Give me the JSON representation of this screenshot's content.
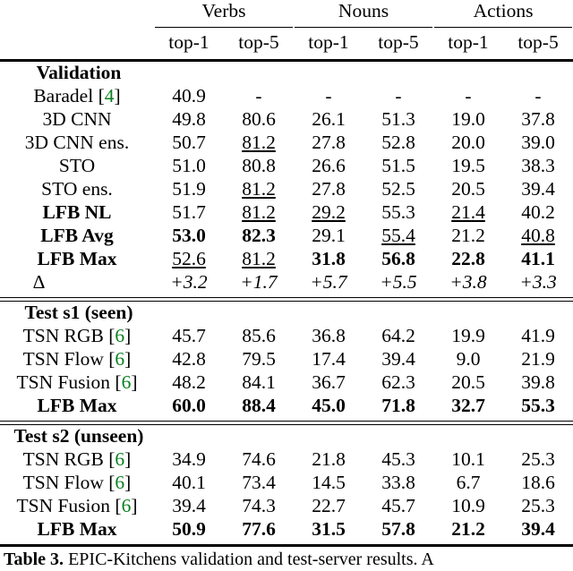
{
  "figure": {
    "kind": "results-table",
    "caption_prefix": "Table 3.",
    "caption_text": " EPIC-Kitchens validation and test-server results. A"
  },
  "table": {
    "column_groups": [
      {
        "label": "Verbs",
        "span": 2
      },
      {
        "label": "Nouns",
        "span": 2
      },
      {
        "label": "Actions",
        "span": 2
      }
    ],
    "subheaders": [
      "top-1",
      "top-5",
      "top-1",
      "top-5",
      "top-1",
      "top-5"
    ],
    "label_header": "",
    "cite_color": "#0a8020",
    "sections": [
      {
        "title": "Validation",
        "rows": [
          {
            "label": "Baradel",
            "cite": "4",
            "bold_label": false,
            "values": [
              "40.9",
              "-",
              "-",
              "-",
              "-",
              "-"
            ],
            "bold": [
              false,
              false,
              false,
              false,
              false,
              false
            ],
            "underline": [
              false,
              false,
              false,
              false,
              false,
              false
            ]
          },
          {
            "label": "3D CNN",
            "cite": null,
            "bold_label": false,
            "values": [
              "49.8",
              "80.6",
              "26.1",
              "51.3",
              "19.0",
              "37.8"
            ],
            "bold": [
              false,
              false,
              false,
              false,
              false,
              false
            ],
            "underline": [
              false,
              false,
              false,
              false,
              false,
              false
            ]
          },
          {
            "label": "3D CNN ens.",
            "cite": null,
            "bold_label": false,
            "values": [
              "50.7",
              "81.2",
              "27.8",
              "52.8",
              "20.0",
              "39.0"
            ],
            "bold": [
              false,
              false,
              false,
              false,
              false,
              false
            ],
            "underline": [
              false,
              true,
              false,
              false,
              false,
              false
            ]
          },
          {
            "label": "STO",
            "cite": null,
            "bold_label": false,
            "values": [
              "51.0",
              "80.8",
              "26.6",
              "51.5",
              "19.5",
              "38.3"
            ],
            "bold": [
              false,
              false,
              false,
              false,
              false,
              false
            ],
            "underline": [
              false,
              false,
              false,
              false,
              false,
              false
            ]
          },
          {
            "label": "STO ens.",
            "cite": null,
            "bold_label": false,
            "values": [
              "51.9",
              "81.2",
              "27.8",
              "52.5",
              "20.5",
              "39.4"
            ],
            "bold": [
              false,
              false,
              false,
              false,
              false,
              false
            ],
            "underline": [
              false,
              true,
              false,
              false,
              false,
              false
            ]
          },
          {
            "label": "LFB NL",
            "cite": null,
            "bold_label": true,
            "values": [
              "51.7",
              "81.2",
              "29.2",
              "55.3",
              "21.4",
              "40.2"
            ],
            "bold": [
              false,
              false,
              false,
              false,
              false,
              false
            ],
            "underline": [
              false,
              true,
              true,
              false,
              true,
              false
            ]
          },
          {
            "label": "LFB Avg",
            "cite": null,
            "bold_label": true,
            "values": [
              "53.0",
              "82.3",
              "29.1",
              "55.4",
              "21.2",
              "40.8"
            ],
            "bold": [
              true,
              true,
              false,
              false,
              false,
              false
            ],
            "underline": [
              false,
              false,
              false,
              true,
              false,
              true
            ]
          },
          {
            "label": "LFB Max",
            "cite": null,
            "bold_label": true,
            "values": [
              "52.6",
              "81.2",
              "31.8",
              "56.8",
              "22.8",
              "41.1"
            ],
            "bold": [
              false,
              false,
              true,
              true,
              true,
              true
            ],
            "underline": [
              true,
              true,
              false,
              false,
              false,
              false
            ]
          },
          {
            "label": "Δ",
            "cite": null,
            "is_delta": true,
            "bold_label": false,
            "values": [
              "+3.2",
              "+1.7",
              "+5.7",
              "+5.5",
              "+3.8",
              "+3.3"
            ],
            "bold": [
              false,
              false,
              false,
              false,
              false,
              false
            ],
            "underline": [
              false,
              false,
              false,
              false,
              false,
              false
            ]
          }
        ]
      },
      {
        "title": "Test s1 (seen)",
        "rows": [
          {
            "label": "TSN RGB",
            "cite": "6",
            "bold_label": false,
            "values": [
              "45.7",
              "85.6",
              "36.8",
              "64.2",
              "19.9",
              "41.9"
            ],
            "bold": [
              false,
              false,
              false,
              false,
              false,
              false
            ],
            "underline": [
              false,
              false,
              false,
              false,
              false,
              false
            ]
          },
          {
            "label": "TSN Flow",
            "cite": "6",
            "bold_label": false,
            "values": [
              "42.8",
              "79.5",
              "17.4",
              "39.4",
              "9.0",
              "21.9"
            ],
            "bold": [
              false,
              false,
              false,
              false,
              false,
              false
            ],
            "underline": [
              false,
              false,
              false,
              false,
              false,
              false
            ]
          },
          {
            "label": "TSN Fusion",
            "cite": "6",
            "bold_label": false,
            "values": [
              "48.2",
              "84.1",
              "36.7",
              "62.3",
              "20.5",
              "39.8"
            ],
            "bold": [
              false,
              false,
              false,
              false,
              false,
              false
            ],
            "underline": [
              false,
              false,
              false,
              false,
              false,
              false
            ]
          },
          {
            "label": "LFB Max",
            "cite": null,
            "bold_label": true,
            "values": [
              "60.0",
              "88.4",
              "45.0",
              "71.8",
              "32.7",
              "55.3"
            ],
            "bold": [
              true,
              true,
              true,
              true,
              true,
              true
            ],
            "underline": [
              false,
              false,
              false,
              false,
              false,
              false
            ]
          }
        ]
      },
      {
        "title": "Test s2 (unseen)",
        "rows": [
          {
            "label": "TSN RGB",
            "cite": "6",
            "bold_label": false,
            "values": [
              "34.9",
              "74.6",
              "21.8",
              "45.3",
              "10.1",
              "25.3"
            ],
            "bold": [
              false,
              false,
              false,
              false,
              false,
              false
            ],
            "underline": [
              false,
              false,
              false,
              false,
              false,
              false
            ]
          },
          {
            "label": "TSN Flow",
            "cite": "6",
            "bold_label": false,
            "values": [
              "40.1",
              "73.4",
              "14.5",
              "33.8",
              "6.7",
              "18.6"
            ],
            "bold": [
              false,
              false,
              false,
              false,
              false,
              false
            ],
            "underline": [
              false,
              false,
              false,
              false,
              false,
              false
            ]
          },
          {
            "label": "TSN Fusion",
            "cite": "6",
            "bold_label": false,
            "values": [
              "39.4",
              "74.3",
              "22.7",
              "45.7",
              "10.9",
              "25.3"
            ],
            "bold": [
              false,
              false,
              false,
              false,
              false,
              false
            ],
            "underline": [
              false,
              false,
              false,
              false,
              false,
              false
            ]
          },
          {
            "label": "LFB Max",
            "cite": null,
            "bold_label": true,
            "values": [
              "50.9",
              "77.6",
              "31.5",
              "57.8",
              "21.2",
              "39.4"
            ],
            "bold": [
              true,
              true,
              true,
              true,
              true,
              true
            ],
            "underline": [
              false,
              false,
              false,
              false,
              false,
              false
            ]
          }
        ]
      }
    ]
  }
}
